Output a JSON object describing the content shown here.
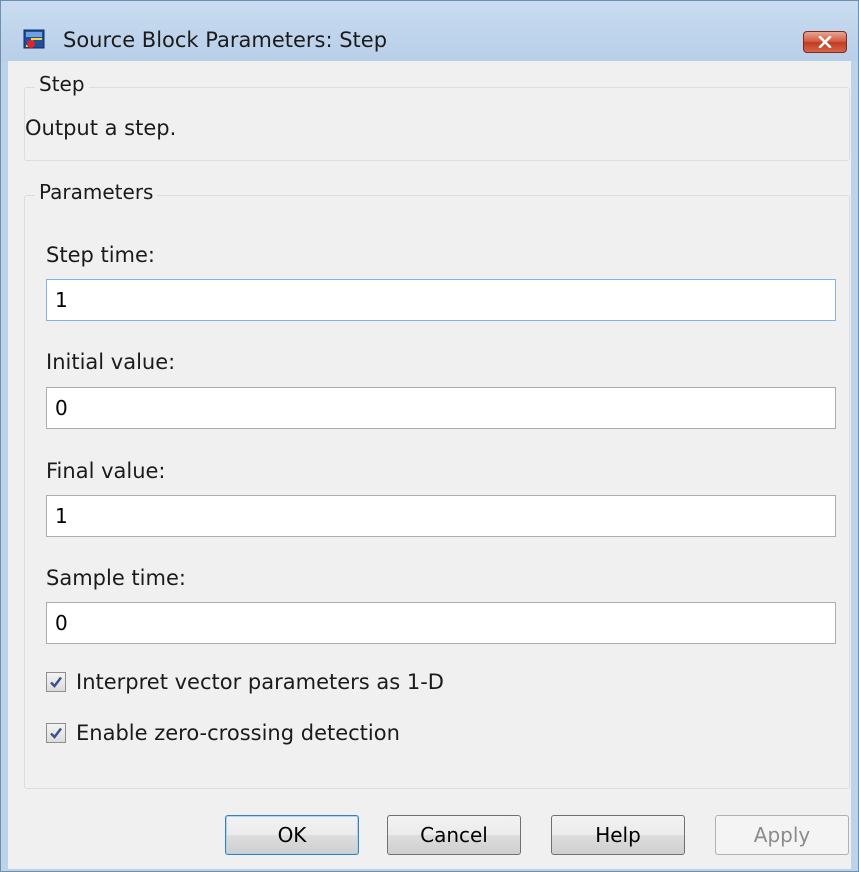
{
  "window": {
    "title": "Source Block Parameters: Step",
    "app_icon": "simulink-block-icon",
    "close_icon": "close-icon"
  },
  "description_group": {
    "title": "Step",
    "text": "Output a step."
  },
  "parameters_group": {
    "title": "Parameters",
    "fields": [
      {
        "label": "Step time:",
        "value": "1"
      },
      {
        "label": "Initial value:",
        "value": "0"
      },
      {
        "label": "Final value:",
        "value": "1"
      },
      {
        "label": "Sample time:",
        "value": "0"
      }
    ],
    "checkboxes": [
      {
        "label": "Interpret vector parameters as 1-D",
        "checked": true
      },
      {
        "label": "Enable zero-crossing detection",
        "checked": true
      }
    ]
  },
  "buttons": {
    "ok": "OK",
    "cancel": "Cancel",
    "help": "Help",
    "apply": "Apply"
  },
  "colors": {
    "titlebar": "#bdd3ea",
    "close_button": "#c94a2f",
    "focus_border": "#7eb4ea",
    "checkmark": "#3a4f8c"
  }
}
